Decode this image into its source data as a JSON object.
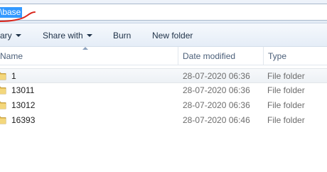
{
  "address": {
    "path": "\\base"
  },
  "toolbar": {
    "organize_label": "ary",
    "share_label": "Share with",
    "burn_label": "Burn",
    "new_folder_label": "New folder"
  },
  "columns": {
    "name": "Name",
    "date_modified": "Date modified",
    "type": "Type"
  },
  "files": [
    {
      "name": "1",
      "date_modified": "28-07-2020 06:36",
      "type": "File folder",
      "selected": true
    },
    {
      "name": "13011",
      "date_modified": "28-07-2020 06:36",
      "type": "File folder",
      "selected": false
    },
    {
      "name": "13012",
      "date_modified": "28-07-2020 06:36",
      "type": "File folder",
      "selected": false
    },
    {
      "name": "16393",
      "date_modified": "28-07-2020 06:46",
      "type": "File folder",
      "selected": false
    }
  ],
  "colors": {
    "selection": "#3399ff",
    "annotation_pen": "#d9261c",
    "folder": "#e8c15a"
  }
}
